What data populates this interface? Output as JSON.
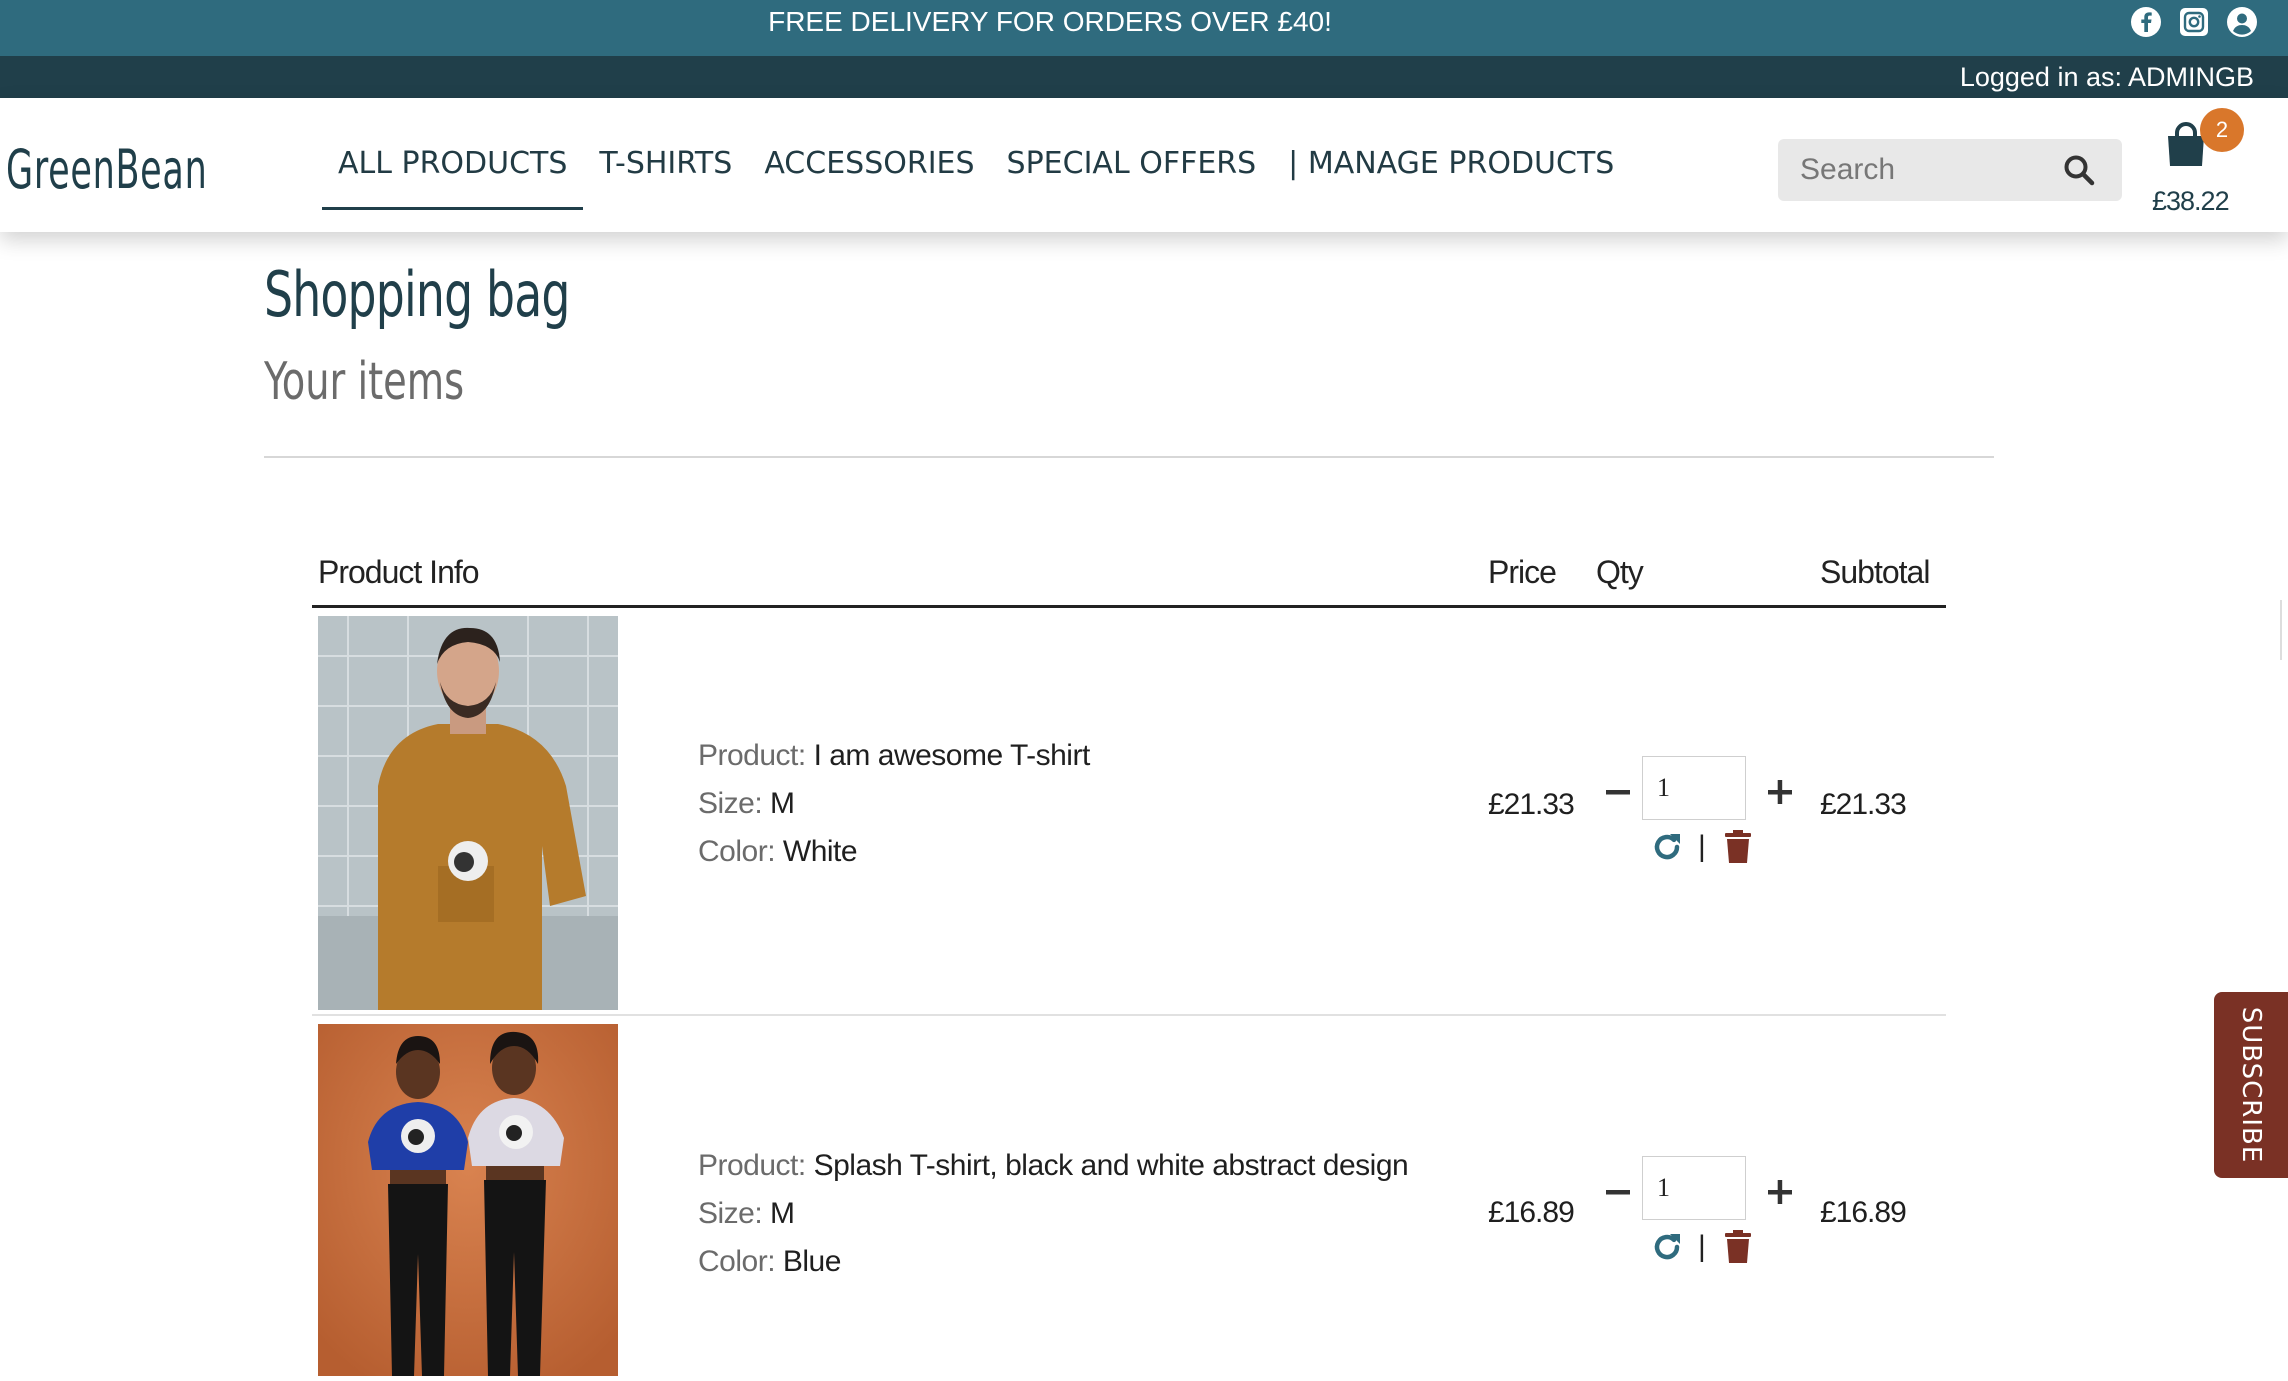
{
  "banner": {
    "promo": "FREE DELIVERY FOR ORDERS OVER £40!",
    "icons": [
      "facebook-icon",
      "instagram-icon",
      "user-icon"
    ]
  },
  "login": {
    "text": "Logged in as: ADMINGB"
  },
  "nav": {
    "logo": "GreenBean",
    "links": [
      "ALL PRODUCTS",
      "T-SHIRTS",
      "ACCESSORIES",
      "SPECIAL OFFERS",
      "| MANAGE PRODUCTS"
    ],
    "active_link": "ALL PRODUCTS",
    "search_placeholder": "Search",
    "bag_count": "2",
    "bag_total": "£38.22"
  },
  "page": {
    "title": "Shopping bag",
    "subtitle": "Your items"
  },
  "table": {
    "headers": {
      "info": "Product Info",
      "price": "Price",
      "qty": "Qty",
      "subtotal": "Subtotal"
    },
    "labels": {
      "product": "Product:",
      "size": "Size:",
      "color": "Color:"
    },
    "separator": "|",
    "rows": [
      {
        "product": "I am awesome T-shirt",
        "size": "M",
        "color": "White",
        "price": "£21.33",
        "qty": "1",
        "subtotal": "£21.33"
      },
      {
        "product": "Splash T-shirt, black and white abstract design",
        "size": "M",
        "color": "Blue",
        "price": "£16.89",
        "qty": "1",
        "subtotal": "£16.89"
      }
    ]
  },
  "subscribe": {
    "label": "SUBSCRIBE"
  },
  "colors": {
    "banner": "#2f6b7e",
    "login_bar": "#203f4a",
    "accent": "#d9772b",
    "delete": "#7a3125",
    "subscribe": "#7a3125"
  }
}
